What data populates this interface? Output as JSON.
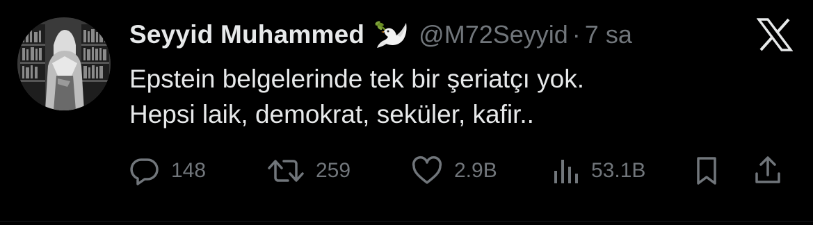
{
  "tweet": {
    "author": {
      "display_name": "Seyyid Muhammed",
      "name_emoji_icon": "dove-with-olive-branch-icon",
      "handle": "@M72Seyyid",
      "separator": "·",
      "time": "7 sa"
    },
    "text_lines": [
      "Epstein belgelerinde tek bir şeriatçı yok.",
      "Hepsi laik, demokrat, seküler, kafir.."
    ],
    "actions": {
      "replies": "148",
      "retweets": "259",
      "likes": "2.9B",
      "views": "53.1B"
    }
  },
  "colors": {
    "background": "#000000",
    "primary_text": "#e7e9ea",
    "secondary_text": "#71767b"
  }
}
